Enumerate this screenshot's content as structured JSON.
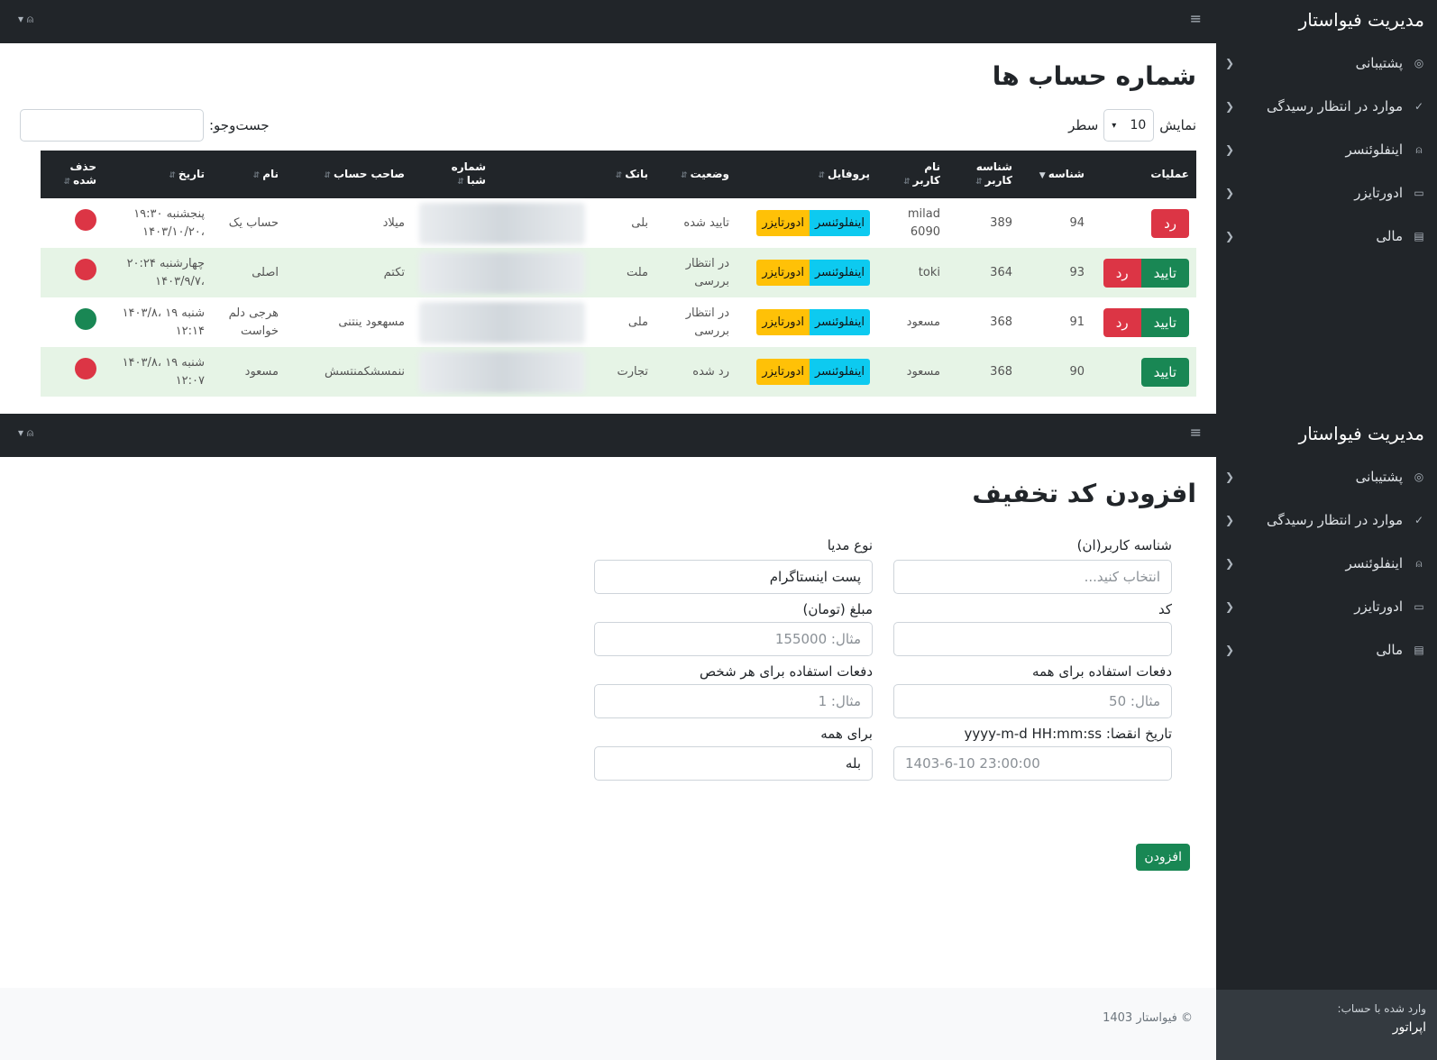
{
  "brand": "مدیریت فیواستار",
  "sidebar": [
    {
      "label": "پشتیبانی",
      "icon": "support-icon"
    },
    {
      "label": "موارد در انتظار رسیدگی",
      "icon": "check-icon"
    },
    {
      "label": "اینفلوئنسر",
      "icon": "user-icon"
    },
    {
      "label": "ادورتایزر",
      "icon": "monitor-icon"
    },
    {
      "label": "مالی",
      "icon": "money-icon"
    }
  ],
  "table_page": {
    "title": "شماره حساب ها",
    "length_prefix": "نمایش",
    "length_value": "10",
    "length_suffix": "سطر",
    "search_label": "جست‌وجو:",
    "columns": [
      "عملیات",
      "شناسه",
      "شناسه کاربر",
      "نام کاربر",
      "پروفایل",
      "وضعیت",
      "بانک",
      "شماره شبا",
      "صاحب حساب",
      "نام",
      "تاریخ",
      "حذف شده"
    ],
    "approve_label": "تایید",
    "reject_label": "رد",
    "badge_influencer": "اینفلوئنسر",
    "badge_advertiser": "ادورتایزر",
    "rows": [
      {
        "id": "94",
        "user_id": "389",
        "username": "milad 6090",
        "status": "تایید شده",
        "bank": "بلی",
        "owner": "میلاد",
        "name": "حساب یک",
        "date": "پنجشنبه ۱۹:۳۰ ،۱۴۰۳/۱۰/۲۰"
      },
      {
        "id": "93",
        "user_id": "364",
        "username": "toki",
        "status": "در انتظار بررسی",
        "bank": "ملت",
        "owner": "تکتم",
        "name": "اصلی",
        "date": "چهارشنبه ۲۰:۲۴ ،۱۴۰۳/۹/۷"
      },
      {
        "id": "91",
        "user_id": "368",
        "username": "مسعود",
        "status": "در انتظار بررسی",
        "bank": "ملی",
        "owner": "مسهعود ینتنی",
        "name": "هرجی دلم خواست",
        "date": "شنبه ۱۹ ،۱۴۰۳/۸ ۱۲:۱۴"
      },
      {
        "id": "90",
        "user_id": "368",
        "username": "مسعود",
        "status": "رد شده",
        "bank": "تجارت",
        "owner": "ننمسشکمنتسش",
        "name": "مسعود",
        "date": "شنبه ۱۹ ،۱۴۰۳/۸ ۱۲:۰۷"
      }
    ]
  },
  "form_page": {
    "title": "افزودن کد تخفیف",
    "fields": {
      "user_ids": {
        "label": "شناسه کاربر(ان)",
        "placeholder": "انتخاب کنید..."
      },
      "media_type": {
        "label": "نوع مدیا",
        "value": "پست اینستاگرام"
      },
      "code": {
        "label": "کد",
        "value": ""
      },
      "amount": {
        "label": "مبلغ (تومان)",
        "placeholder": "مثال: 155000"
      },
      "total_uses": {
        "label": "دفعات استفاده برای همه",
        "placeholder": "مثال: 50"
      },
      "per_person_uses": {
        "label": "دفعات استفاده برای هر شخص",
        "placeholder": "مثال: 1"
      },
      "expiry": {
        "label": "تاریخ انقضا: yyyy-m-d HH:mm:ss",
        "placeholder": "1403-6-10 23:00:00"
      },
      "for_all": {
        "label": "برای همه",
        "value": "بله"
      }
    },
    "submit_label": "افزودن",
    "copyright": "© فیواستار 1403",
    "logged_in_as": "وارد شده با حساب:",
    "operator": "اپراتور"
  },
  "colors": {
    "sidebar": "#212529",
    "approve": "#198754",
    "reject": "#dc3545",
    "badge_influencer": "#0dcaf0",
    "badge_advertiser": "#ffc107",
    "row_highlight": "#e6f4e6"
  },
  "deleted_flags": [
    true,
    true,
    false,
    true
  ]
}
